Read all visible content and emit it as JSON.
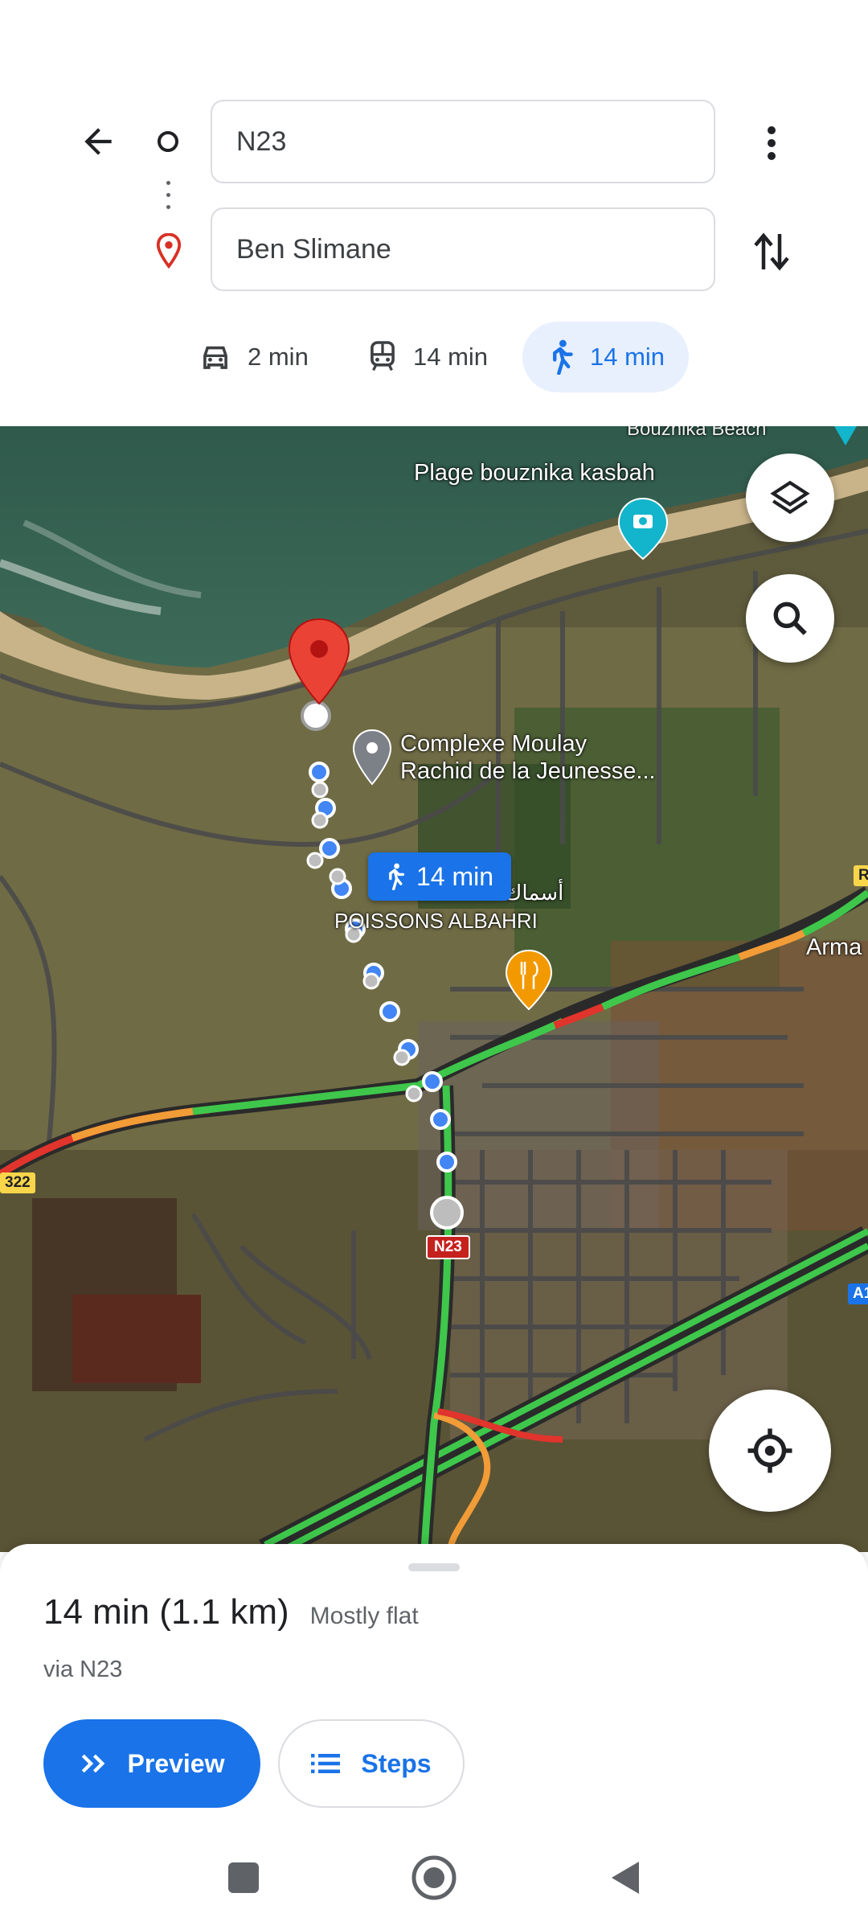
{
  "directions": {
    "origin": "N23",
    "destination": "Ben Slimane"
  },
  "modes": [
    {
      "icon": "car-icon",
      "label": "2 min",
      "active": false
    },
    {
      "icon": "transit-icon",
      "label": "14 min",
      "active": false
    },
    {
      "icon": "walk-icon",
      "label": "14 min",
      "active": true
    }
  ],
  "map": {
    "labels": {
      "beach": "Plage bouznika kasbah",
      "complex_line1": "Complexe Moulay",
      "complex_line2": "Rachid de la Jeunesse...",
      "restaurant_ar": "أسماك",
      "restaurant": "POISSONS ALBAHRI",
      "arma": "Arma",
      "top_cut": "Bouznika Beach"
    },
    "walk_chip": "14 min",
    "shields": {
      "n23": "N23",
      "r322": "322",
      "r_right": "R",
      "a1": "A1"
    },
    "colors": {
      "route_walk": "#4285f4",
      "traffic_green": "#3ec74b",
      "traffic_orange": "#f29c38",
      "traffic_red": "#e0342c",
      "accent": "#1a73e8"
    }
  },
  "sheet": {
    "duration": "14 min (1.1 km)",
    "terrain": "Mostly flat",
    "via": "via N23",
    "preview_label": "Preview",
    "steps_label": "Steps"
  }
}
